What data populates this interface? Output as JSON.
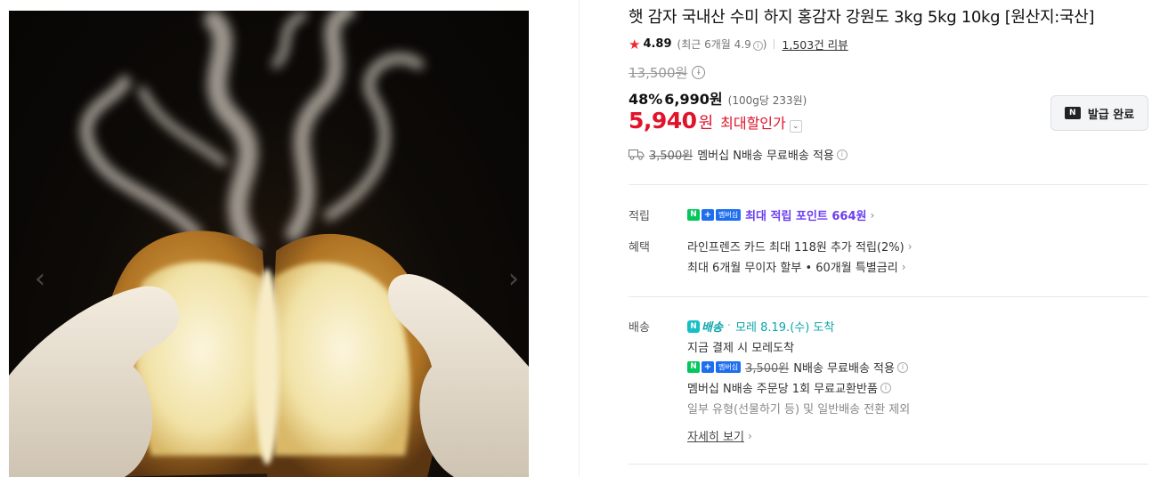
{
  "gallery": {
    "image_alt": "김이 나는 구운 감자를 면장갑 낀 손으로 쪼개는 사진",
    "prev_icon": "chevron-left-icon",
    "next_icon": "chevron-right-icon",
    "prev_glyph": "‹",
    "next_glyph": "›"
  },
  "product": {
    "title": "햇 감자 국내산 수미 하지 홍감자 강원도 3kg 5kg 10kg [원산지:국산]",
    "rating_star": "★",
    "rating": "4.89",
    "rating_recent": "(최근 6개월 4.9",
    "rating_info_glyph": "i",
    "rating_recent_close": ")",
    "review_count": "1,503건 리뷰"
  },
  "price": {
    "original": "13,500원",
    "info_glyph": "i",
    "discount": "48%",
    "sale": "6,990원",
    "unit": "(100g당 233원)",
    "max_price": "5,940",
    "max_won": "원",
    "max_label": "최대할인가",
    "max_chevron": "⌄",
    "accent_color": "#e0132a"
  },
  "coupon": {
    "icon_text": "N",
    "label": "발급 완료"
  },
  "shipping_summary": {
    "fee_struck": "3,500원",
    "text": "멤버십 N배송 무료배송 적용",
    "info_glyph": "i"
  },
  "benefits": {
    "points_label": "적립",
    "points_badge_n": "N",
    "points_badge_plus": "+",
    "points_badge_member": "멤버십",
    "points_text": "최대 적립 포인트 664원",
    "benefit_label": "혜택",
    "card_text": "라인프렌즈 카드 최대 118원 추가 적립(2%)",
    "installment_text": "최대 6개월 무이자 할부 • 60개월 특별금리",
    "chevron": "›"
  },
  "delivery": {
    "label": "배송",
    "n_icon": "N",
    "n_label": "배송",
    "dot": "·",
    "arrival": "모레 8.19.(수) 도착",
    "pay_now": "지금 결제 시 모레도착",
    "member_badge_n": "N",
    "member_badge_plus": "+",
    "member_badge_label": "멤버십",
    "member_fee_struck": "3,500원",
    "member_text": "N배송 무료배송 적용",
    "exchange_text": "멤버십 N배송 주문당 1회 무료교환반품",
    "exclusion_text": "일부 유형(선물하기 등) 및 일반배송 전환 제외",
    "detail_link": "자세히 보기",
    "info_glyph": "i",
    "chevron": "›"
  }
}
